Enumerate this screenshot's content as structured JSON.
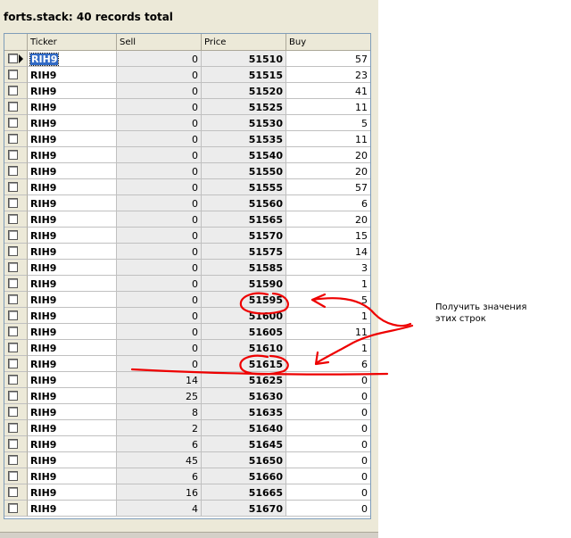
{
  "window": {
    "title": "forts.stack: 40 records total"
  },
  "table": {
    "columns": [
      "Ticker",
      "Sell",
      "Price",
      "Buy"
    ],
    "rows": [
      {
        "ticker": "RIH9",
        "sell": "0",
        "price": "51510",
        "buy": "57"
      },
      {
        "ticker": "RIH9",
        "sell": "0",
        "price": "51515",
        "buy": "23"
      },
      {
        "ticker": "RIH9",
        "sell": "0",
        "price": "51520",
        "buy": "41"
      },
      {
        "ticker": "RIH9",
        "sell": "0",
        "price": "51525",
        "buy": "11"
      },
      {
        "ticker": "RIH9",
        "sell": "0",
        "price": "51530",
        "buy": "5"
      },
      {
        "ticker": "RIH9",
        "sell": "0",
        "price": "51535",
        "buy": "11"
      },
      {
        "ticker": "RIH9",
        "sell": "0",
        "price": "51540",
        "buy": "20"
      },
      {
        "ticker": "RIH9",
        "sell": "0",
        "price": "51550",
        "buy": "20"
      },
      {
        "ticker": "RIH9",
        "sell": "0",
        "price": "51555",
        "buy": "57"
      },
      {
        "ticker": "RIH9",
        "sell": "0",
        "price": "51560",
        "buy": "6"
      },
      {
        "ticker": "RIH9",
        "sell": "0",
        "price": "51565",
        "buy": "20"
      },
      {
        "ticker": "RIH9",
        "sell": "0",
        "price": "51570",
        "buy": "15"
      },
      {
        "ticker": "RIH9",
        "sell": "0",
        "price": "51575",
        "buy": "14"
      },
      {
        "ticker": "RIH9",
        "sell": "0",
        "price": "51585",
        "buy": "3"
      },
      {
        "ticker": "RIH9",
        "sell": "0",
        "price": "51590",
        "buy": "1"
      },
      {
        "ticker": "RIH9",
        "sell": "0",
        "price": "51595",
        "buy": "5"
      },
      {
        "ticker": "RIH9",
        "sell": "0",
        "price": "51600",
        "buy": "1"
      },
      {
        "ticker": "RIH9",
        "sell": "0",
        "price": "51605",
        "buy": "11"
      },
      {
        "ticker": "RIH9",
        "sell": "0",
        "price": "51610",
        "buy": "1"
      },
      {
        "ticker": "RIH9",
        "sell": "0",
        "price": "51615",
        "buy": "6"
      },
      {
        "ticker": "RIH9",
        "sell": "14",
        "price": "51625",
        "buy": "0"
      },
      {
        "ticker": "RIH9",
        "sell": "25",
        "price": "51630",
        "buy": "0"
      },
      {
        "ticker": "RIH9",
        "sell": "8",
        "price": "51635",
        "buy": "0"
      },
      {
        "ticker": "RIH9",
        "sell": "2",
        "price": "51640",
        "buy": "0"
      },
      {
        "ticker": "RIH9",
        "sell": "6",
        "price": "51645",
        "buy": "0"
      },
      {
        "ticker": "RIH9",
        "sell": "45",
        "price": "51650",
        "buy": "0"
      },
      {
        "ticker": "RIH9",
        "sell": "6",
        "price": "51660",
        "buy": "0"
      },
      {
        "ticker": "RIH9",
        "sell": "16",
        "price": "51665",
        "buy": "0"
      },
      {
        "ticker": "RIH9",
        "sell": "4",
        "price": "51670",
        "buy": "0"
      }
    ]
  },
  "annotation": {
    "line1": "Получить значения",
    "line2": "этих строк",
    "ink_color": "#ee0000"
  }
}
